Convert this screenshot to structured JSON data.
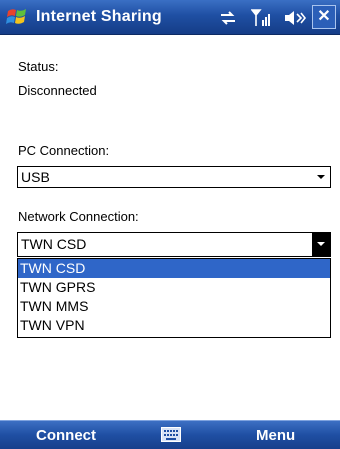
{
  "titlebar": {
    "title": "Internet Sharing",
    "icons": [
      "windows-flag-icon",
      "connectivity-icon",
      "signal-icon",
      "volume-icon",
      "close-icon"
    ],
    "close_label": "✕"
  },
  "status": {
    "label": "Status:",
    "value": "Disconnected"
  },
  "pc_connection": {
    "label": "PC Connection:",
    "value": "USB"
  },
  "network_connection": {
    "label": "Network Connection:",
    "value": "TWN CSD",
    "options": [
      "TWN CSD",
      "TWN GPRS",
      "TWN MMS",
      "TWN VPN"
    ],
    "selected_index": 0
  },
  "softbar": {
    "left": "Connect",
    "right": "Menu",
    "center_icon": "keyboard-icon"
  },
  "colors": {
    "titlebar": "#1f4fa3",
    "selection": "#2f66c8",
    "softbar": "#1f4fa3"
  }
}
